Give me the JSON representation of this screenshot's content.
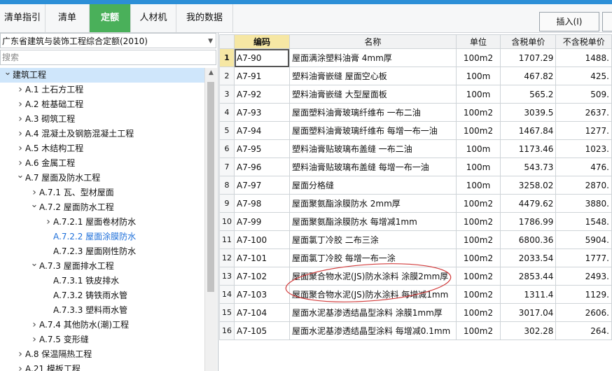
{
  "tabs": [
    {
      "label": "清单指引",
      "active": false
    },
    {
      "label": "清单",
      "active": false
    },
    {
      "label": "定额",
      "active": true
    },
    {
      "label": "人材机",
      "active": false
    },
    {
      "label": "我的数据",
      "active": false
    }
  ],
  "toolbar": {
    "insert_label": "插入(I)"
  },
  "left": {
    "library": "广东省建筑与装饰工程综合定额(2010)",
    "search_placeholder": "搜索"
  },
  "tree": [
    {
      "text": "建筑工程",
      "level": 0,
      "arrow": "down",
      "selected": false,
      "highlight": true
    },
    {
      "text": "A.1 土石方工程",
      "level": 1,
      "arrow": "right"
    },
    {
      "text": "A.2 桩基础工程",
      "level": 1,
      "arrow": "right"
    },
    {
      "text": "A.3 砌筑工程",
      "level": 1,
      "arrow": "right"
    },
    {
      "text": "A.4 混凝土及钢筋混凝土工程",
      "level": 1,
      "arrow": "right"
    },
    {
      "text": "A.5 木结构工程",
      "level": 1,
      "arrow": "right"
    },
    {
      "text": "A.6 金属工程",
      "level": 1,
      "arrow": "right"
    },
    {
      "text": "A.7 屋面及防水工程",
      "level": 1,
      "arrow": "down"
    },
    {
      "text": "A.7.1 瓦、型材屋面",
      "level": 2,
      "arrow": "right"
    },
    {
      "text": "A.7.2 屋面防水工程",
      "level": 2,
      "arrow": "down"
    },
    {
      "text": "A.7.2.1 屋面卷材防水",
      "level": 3,
      "arrow": "right"
    },
    {
      "text": "A.7.2.2 屋面涂膜防水",
      "level": 3,
      "arrow": "",
      "selected": true
    },
    {
      "text": "A.7.2.3 屋面刚性防水",
      "level": 3,
      "arrow": ""
    },
    {
      "text": "A.7.3 屋面排水工程",
      "level": 2,
      "arrow": "down"
    },
    {
      "text": "A.7.3.1 铁皮排水",
      "level": 3,
      "arrow": ""
    },
    {
      "text": "A.7.3.2 铸铁雨水管",
      "level": 3,
      "arrow": ""
    },
    {
      "text": "A.7.3.3 塑料雨水管",
      "level": 3,
      "arrow": ""
    },
    {
      "text": "A.7.4 其他防水(潮)工程",
      "level": 2,
      "arrow": "right"
    },
    {
      "text": "A.7.5 变形缝",
      "level": 2,
      "arrow": "right"
    },
    {
      "text": "A.8 保温隔热工程",
      "level": 1,
      "arrow": "right"
    },
    {
      "text": "A.21 模板工程",
      "level": 1,
      "arrow": "right"
    }
  ],
  "table": {
    "headers": [
      "编码",
      "名称",
      "单位",
      "含税单价",
      "不含税单价"
    ],
    "rows": [
      {
        "no": "1",
        "code": "A7-90",
        "name": "屋面满涂塑料油膏 4mm厚",
        "unit": "100m2",
        "tax": "1707.29",
        "notax": "1488."
      },
      {
        "no": "2",
        "code": "A7-91",
        "name": "塑料油膏嵌缝 屋面空心板",
        "unit": "100m",
        "tax": "467.82",
        "notax": "425."
      },
      {
        "no": "3",
        "code": "A7-92",
        "name": "塑料油膏嵌缝 大型屋面板",
        "unit": "100m",
        "tax": "565.2",
        "notax": "509."
      },
      {
        "no": "4",
        "code": "A7-93",
        "name": "屋面塑料油膏玻璃纤维布 一布二油",
        "unit": "100m2",
        "tax": "3039.5",
        "notax": "2637."
      },
      {
        "no": "5",
        "code": "A7-94",
        "name": "屋面塑料油膏玻璃纤维布 每增一布一油",
        "unit": "100m2",
        "tax": "1467.84",
        "notax": "1277."
      },
      {
        "no": "6",
        "code": "A7-95",
        "name": "塑料油膏贴玻璃布盖缝 一布二油",
        "unit": "100m",
        "tax": "1173.46",
        "notax": "1023."
      },
      {
        "no": "7",
        "code": "A7-96",
        "name": "塑料油膏贴玻璃布盖缝 每增一布一油",
        "unit": "100m",
        "tax": "543.73",
        "notax": "476."
      },
      {
        "no": "8",
        "code": "A7-97",
        "name": "屋面分格缝",
        "unit": "100m",
        "tax": "3258.02",
        "notax": "2870."
      },
      {
        "no": "9",
        "code": "A7-98",
        "name": "屋面聚氨酯涂膜防水 2mm厚",
        "unit": "100m2",
        "tax": "4479.62",
        "notax": "3880."
      },
      {
        "no": "10",
        "code": "A7-99",
        "name": "屋面聚氨酯涂膜防水 每增减1mm",
        "unit": "100m2",
        "tax": "1786.99",
        "notax": "1548."
      },
      {
        "no": "11",
        "code": "A7-100",
        "name": "屋面氯丁冷胶 二布三涂",
        "unit": "100m2",
        "tax": "6800.36",
        "notax": "5904."
      },
      {
        "no": "12",
        "code": "A7-101",
        "name": "屋面氯丁冷胶 每增一布一涂",
        "unit": "100m2",
        "tax": "2033.54",
        "notax": "1777."
      },
      {
        "no": "13",
        "code": "A7-102",
        "name": "屋面聚合物水泥(JS)防水涂料 涂膜2mm厚",
        "unit": "100m2",
        "tax": "2853.44",
        "notax": "2493."
      },
      {
        "no": "14",
        "code": "A7-103",
        "name": "屋面聚合物水泥(JS)防水涂料 每增减1mm",
        "unit": "100m2",
        "tax": "1311.4",
        "notax": "1129."
      },
      {
        "no": "15",
        "code": "A7-104",
        "name": "屋面水泥基渗透结晶型涂料 涂膜1mm厚",
        "unit": "100m2",
        "tax": "3017.04",
        "notax": "2606."
      },
      {
        "no": "16",
        "code": "A7-105",
        "name": "屋面水泥基渗透结晶型涂料 每增减0.1mm",
        "unit": "100m2",
        "tax": "302.28",
        "notax": "264."
      }
    ]
  },
  "colors": {
    "active_tab": "#4ab05a",
    "highlight": "#cfe6fb",
    "selected_text": "#1e6fd9",
    "annotation": "#d23c3c"
  }
}
